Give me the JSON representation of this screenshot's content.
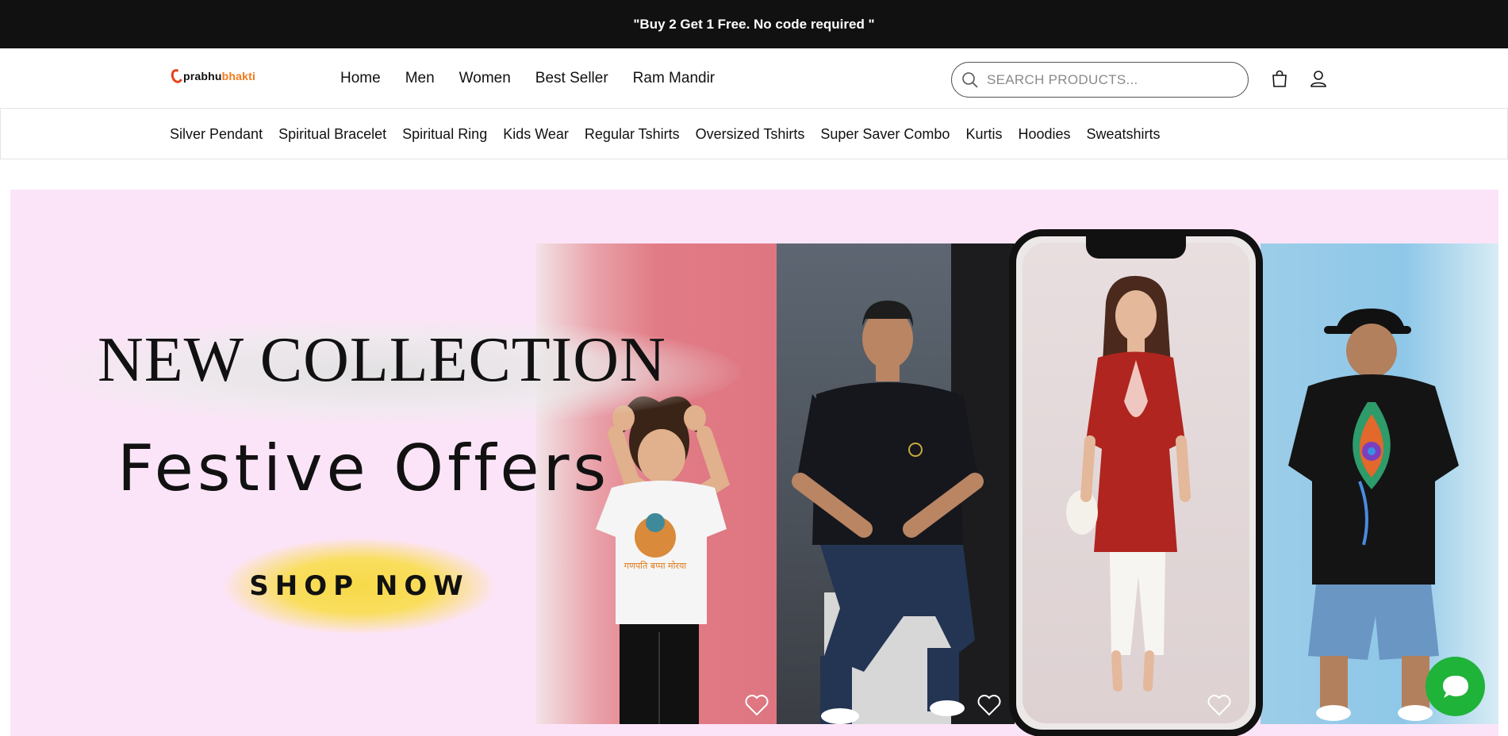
{
  "announcement": "\"Buy 2 Get 1 Free. No code required \"",
  "logo": {
    "part1": "prabhu",
    "part2": "bhakti"
  },
  "main_nav": [
    "Home",
    "Men",
    "Women",
    "Best Seller",
    "Ram Mandir"
  ],
  "search": {
    "placeholder": "SEARCH PRODUCTS..."
  },
  "icons": {
    "search": "search-icon",
    "cart": "shopping-bag-icon",
    "account": "user-icon",
    "wishlist": "heart-icon",
    "chat": "chat-icon"
  },
  "categories": [
    "Silver Pendant",
    "Spiritual Bracelet",
    "Spiritual Ring",
    "Kids Wear",
    "Regular Tshirts",
    "Oversized Tshirts",
    "Super Saver Combo",
    "Kurtis",
    "Hoodies",
    "Sweatshirts"
  ],
  "hero": {
    "title": "NEW COLLECTION",
    "subtitle": "Festive Offers",
    "cta": "SHOP NOW",
    "shirt_text": "गणपति बप्पा मोरया",
    "colors": {
      "background": "#fce4f8",
      "cta": "#f7d94a"
    }
  },
  "colors": {
    "announce_bg": "#111111",
    "logo_accent": "#f07a1a",
    "chat": "#1fb33a"
  }
}
